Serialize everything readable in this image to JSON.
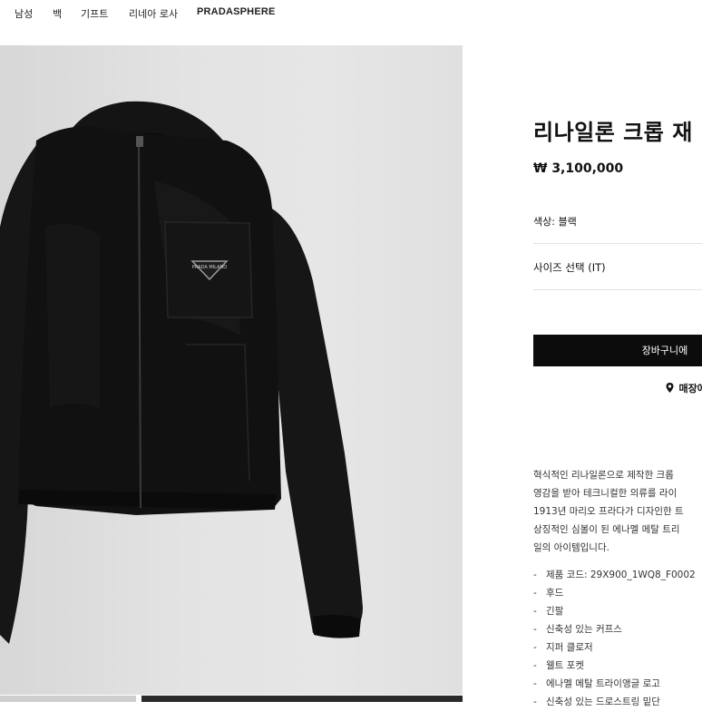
{
  "nav": {
    "items": [
      "남성",
      "백",
      "기프트",
      "리네아 로사",
      "PRADASPHERE"
    ]
  },
  "product": {
    "title": "리나일론 크롭 재",
    "price": "₩ 3,100,000",
    "color_label": "색상:",
    "color_value": "블랙",
    "size_select": "사이즈 선택 (IT)",
    "cart_button": "장바구니에",
    "store_link": "매장에",
    "description_lines": [
      "혁식적인 리나일론으로 제작한 크롭",
      "영감을 받아 테크니컬한 의류를 라이",
      "1913년 마리오 프라다가 디자인한 트",
      "상징적인 심볼이 된 에나멜 메탈 트리",
      "일의 아이템입니다."
    ],
    "specs": [
      "제품 코드: 29X900_1WQ8_F0002",
      "후드",
      "긴팔",
      "신축성 있는 커프스",
      "지퍼 클로저",
      "웰트 포켓",
      "에나멜 메탈 트라이앵글 로고",
      "신축성 있는 드로스트링 밑단"
    ]
  },
  "image": {
    "subject": "black cropped nylon hooded jacket with enamel triangle logo",
    "logo_text": "PRADA MILANO"
  },
  "colors": {
    "accent": "#0c0c0c",
    "background": "#ffffff",
    "photo_bg": "#e2e2e2"
  },
  "icons": {
    "store": "map-pin-icon"
  }
}
